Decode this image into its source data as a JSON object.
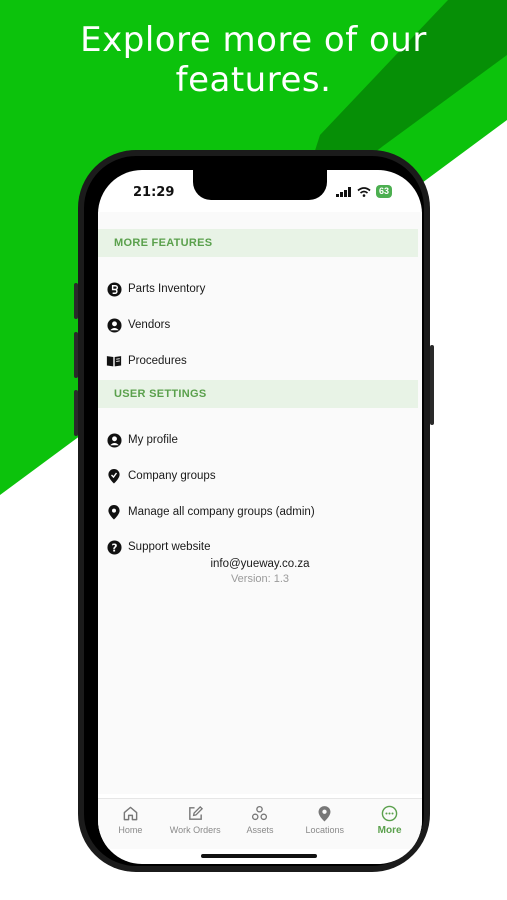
{
  "headline": {
    "line1": "Explore more of our",
    "line2": "features."
  },
  "colors": {
    "bg_green": "#0cc20c",
    "bg_dark_green": "#068f06",
    "accent": "#5aa04c",
    "section_bg": "#e8f3e6"
  },
  "status_bar": {
    "time": "21:29",
    "battery": "63"
  },
  "more_features": {
    "title": "MORE FEATURES",
    "items": [
      {
        "label": "Parts Inventory",
        "icon": "parts-icon"
      },
      {
        "label": "Vendors",
        "icon": "person-icon"
      },
      {
        "label": "Procedures",
        "icon": "book-icon"
      }
    ]
  },
  "user_settings": {
    "title": "USER SETTINGS",
    "items": [
      {
        "label": "My profile",
        "icon": "person-icon"
      },
      {
        "label": "Company groups",
        "icon": "pin-icon"
      },
      {
        "label": "Manage all company groups (admin)",
        "icon": "pin-icon"
      },
      {
        "label": "Support website",
        "icon": "help-icon"
      }
    ]
  },
  "footer": {
    "email": "info@yueway.co.za",
    "version": "Version: 1.3"
  },
  "tabs": [
    {
      "label": "Home",
      "icon": "home-icon"
    },
    {
      "label": "Work Orders",
      "icon": "edit-icon"
    },
    {
      "label": "Assets",
      "icon": "assets-icon"
    },
    {
      "label": "Locations",
      "icon": "location-icon"
    },
    {
      "label": "More",
      "icon": "more-icon",
      "active": true
    }
  ]
}
